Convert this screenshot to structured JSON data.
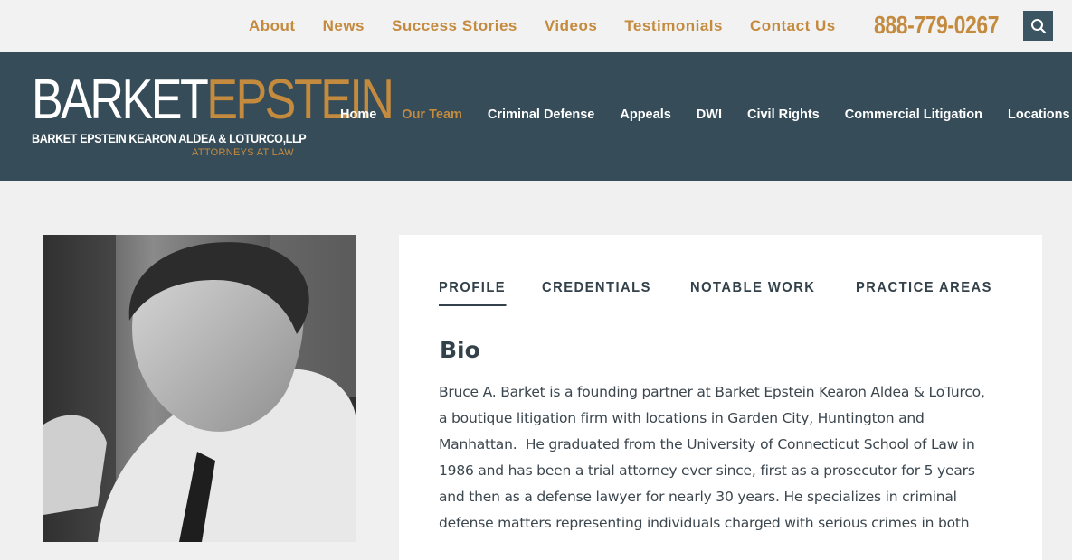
{
  "topnav": {
    "items": [
      "About",
      "News",
      "Success Stories",
      "Videos",
      "Testimonials",
      "Contact Us"
    ],
    "phone": "888-779-0267"
  },
  "logo": {
    "word1": "BARKET",
    "word2": "EPSTEIN",
    "subtitle": "BARKET EPSTEIN KEARON ALDEA & LOTURCO,LLP",
    "tagline": "ATTORNEYS AT LAW"
  },
  "mainnav": {
    "items": [
      "Home",
      "Our Team",
      "Criminal Defense",
      "Appeals",
      "DWI",
      "Civil Rights",
      "Commercial Litigation",
      "Locations"
    ],
    "active": "Our Team"
  },
  "profile": {
    "tabs": [
      "PROFILE",
      "CREDENTIALS",
      "NOTABLE WORK",
      "PRACTICE AREAS"
    ],
    "active_tab": "PROFILE",
    "bio_title": "Bio",
    "bio_lines": [
      "Bruce A. Barket is a founding partner at Barket Epstein Kearon Aldea & LoTurco,",
      "a boutique litigation firm with locations in Garden City, Huntington and",
      "Manhattan.  He graduated from the University of Connecticut School of Law in",
      "1986 and has been a trial attorney ever since, first as a prosecutor for 5 years",
      "and then as a defense lawyer for nearly 30 years. He specializes in criminal",
      "defense matters representing individuals charged with serious crimes in both"
    ]
  },
  "colors": {
    "accent": "#c48a3e",
    "nav_bg": "#364d59",
    "search_bg": "#3b5563",
    "text_dark": "#33414a"
  },
  "icons": {
    "search": "search-icon"
  }
}
